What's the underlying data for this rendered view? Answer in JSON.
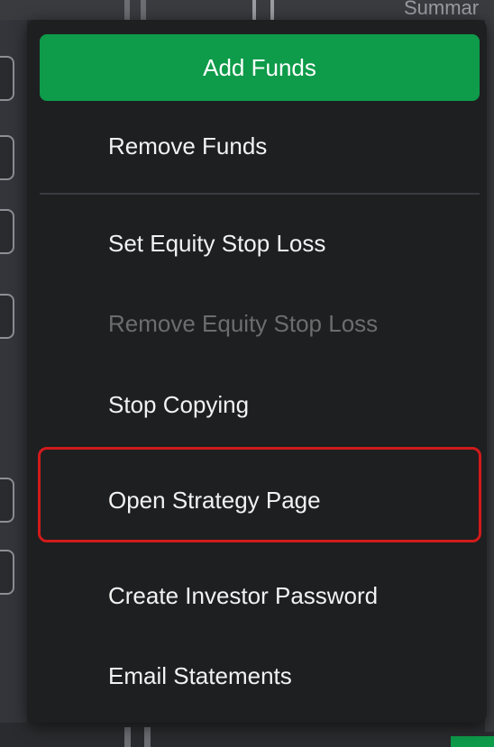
{
  "background": {
    "top_text": "Summar"
  },
  "menu": {
    "add_funds_label": "Add Funds",
    "items": [
      {
        "label": "Remove Funds",
        "enabled": true
      },
      {
        "label": "Set Equity Stop Loss",
        "enabled": true
      },
      {
        "label": "Remove Equity Stop Loss",
        "enabled": false
      },
      {
        "label": "Stop Copying",
        "enabled": true
      },
      {
        "label": "Open Strategy Page",
        "enabled": true,
        "highlighted": true
      },
      {
        "label": "Create Investor Password",
        "enabled": true
      },
      {
        "label": "Email Statements",
        "enabled": true
      }
    ]
  },
  "colors": {
    "menu_background": "#1e1f21",
    "primary_green": "#0e9b4a",
    "highlight_red": "#d11a1a",
    "text_enabled": "#f2f2f2",
    "text_disabled": "#6c6d70"
  }
}
